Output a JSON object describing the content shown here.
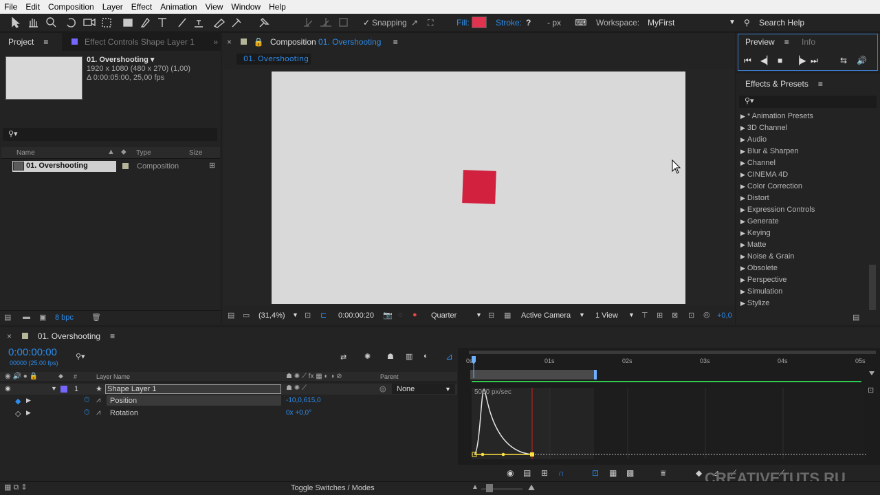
{
  "menu": [
    "File",
    "Edit",
    "Composition",
    "Layer",
    "Effect",
    "Animation",
    "View",
    "Window",
    "Help"
  ],
  "toolbar": {
    "snapping_label": "Snapping",
    "fill_label": "Fill:",
    "fill_color": "#e0334f",
    "stroke_label": "Stroke:",
    "stroke_value": "- px",
    "workspace_label": "Workspace:",
    "workspace_value": "MyFirst",
    "search_help": "Search Help"
  },
  "project": {
    "tab_label": "Project",
    "effect_controls_tab": "Effect Controls Shape Layer 1",
    "comp_name": "01. Overshooting ▾",
    "comp_size": "1920 x 1080  (480 x 270) (1,00)",
    "comp_duration": "Δ 0:00:05:00, 25,00 fps",
    "columns": {
      "name": "Name",
      "type": "Type",
      "size": "Size"
    },
    "item_name": "01. Overshooting",
    "item_type": "Composition",
    "bpc": "8 bpc"
  },
  "composition": {
    "tab_prefix": "Composition",
    "tab_name": "01. Overshooting",
    "breadcrumb": "01. Overshooting",
    "shape_color": "#d1213f",
    "canvas_color": "#d9d9d9",
    "zoom": "(31,4%)",
    "timecode": "0:00:00:20",
    "resolution": "Quarter",
    "camera": "Active Camera",
    "view": "1 View",
    "exposure": "+0,0"
  },
  "preview": {
    "tab_label": "Preview",
    "info_tab": "Info"
  },
  "effects": {
    "title": "Effects & Presets",
    "items": [
      "* Animation Presets",
      "3D Channel",
      "Audio",
      "Blur & Sharpen",
      "Channel",
      "CINEMA 4D",
      "Color Correction",
      "Distort",
      "Expression Controls",
      "Generate",
      "Keying",
      "Matte",
      "Noise & Grain",
      "Obsolete",
      "Perspective",
      "Simulation",
      "Stylize"
    ]
  },
  "timeline": {
    "tab_name": "01. Overshooting",
    "timecode": "0:00:00:00",
    "frames": "00000 (25.00 fps)",
    "col_layer_name": "Layer Name",
    "col_hash": "#",
    "col_parent": "Parent",
    "layer_number": "1",
    "layer_name": "Shape Layer 1",
    "parent_value": "None",
    "prop_position": "Position",
    "prop_position_value": "-10,0,615,0",
    "prop_rotation": "Rotation",
    "prop_rotation_value": "0x +0,0°",
    "ruler": [
      "0s",
      "01s",
      "02s",
      "03s",
      "04s",
      "05s"
    ],
    "graph_label": "5000 px/sec",
    "toggle_label": "Toggle Switches / Modes",
    "watermark": "CREATIVETUTS.RU"
  }
}
